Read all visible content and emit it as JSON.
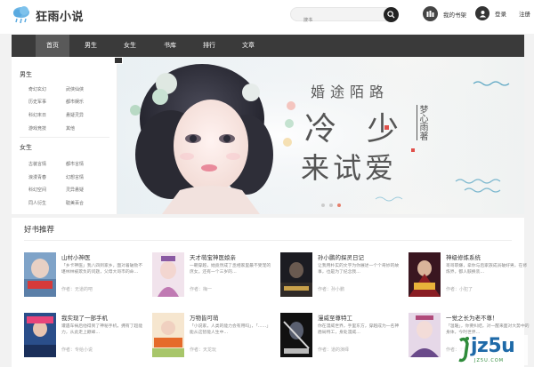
{
  "header": {
    "site_name": "狂雨小说",
    "search_placeholder": "搜书",
    "shelf_label": "我的书架",
    "login_label": "登录",
    "register_label": "注册"
  },
  "nav": {
    "items": [
      "首页",
      "男生",
      "女生",
      "书库",
      "排行",
      "文章"
    ]
  },
  "sidebar": {
    "male_title": "男生",
    "male_items": [
      "奇幻玄幻",
      "武侠仙侠",
      "历史军事",
      "都市娱乐",
      "科幻末日",
      "悬疑灵异",
      "游戏竞技",
      "其他"
    ],
    "female_title": "女生",
    "female_items": [
      "古装言情",
      "都市言情",
      "浪漫青春",
      "幻想言情",
      "科幻空间",
      "灵异悬疑",
      "同人衍生",
      "耽美百合"
    ]
  },
  "banner": {
    "subtitle": "婚途陌路",
    "title_line1": "冷少",
    "title_line2": "来试爱",
    "author": "梦心雨著"
  },
  "section": {
    "title": "好书推荐"
  },
  "books": [
    {
      "title": "山村小神医",
      "desc": "「乡卡神医」我八四到家乡，面对着破败不堪林林被欺负的问题，父母大哥市的命…",
      "author": "作者：无道的吧"
    },
    {
      "title": "天才萌宝神医娘亲",
      "desc": "一朝穿越，她竟然成了丞相家里最不受宠的庶女。还有一个三岁的…",
      "author": "作者：梅一"
    },
    {
      "title": "孙小鹏的探灵日记",
      "desc": "让我用朴实的文字为你展述一个个奇妙的故事，也是为了纪念我…",
      "author": "作者：孙小鹏"
    },
    {
      "title": "神级修炼系统",
      "desc": "哥哥职嫌，拿你与后家族成员破好男，在修炼界，都人骸换装…",
      "author": "作者：小犯了"
    },
    {
      "title": "我实现了一部手机",
      "desc": "遭遇车祸后他得到了神秘手机，拥有了超能力，从此走上巅峰…",
      "author": "作者：专给小说"
    },
    {
      "title": "万物皆可萌",
      "desc": "「小说家，人类的能力会有用吗」，「……」能从这智能人生中…",
      "author": "作者：天龙玩"
    },
    {
      "title": "漫威至尊特工",
      "desc": "你在漫威世界，手里东方，穿越成为一名神盾局特工，身处漫威…",
      "author": "作者：道的演绎"
    },
    {
      "title": "一觉之长为老不尊！",
      "desc": "「温暖」，你要纠结，对一醒来面对大势中的身体，今时世界…",
      "author": "作者：无双"
    }
  ],
  "watermark": {
    "text": "jz5u",
    "sub": "JZ5U.COM"
  },
  "colors": {
    "nav_bg": "#3a3a3a",
    "nav_active": "#595959",
    "accent_dot": "#e57e6a"
  }
}
